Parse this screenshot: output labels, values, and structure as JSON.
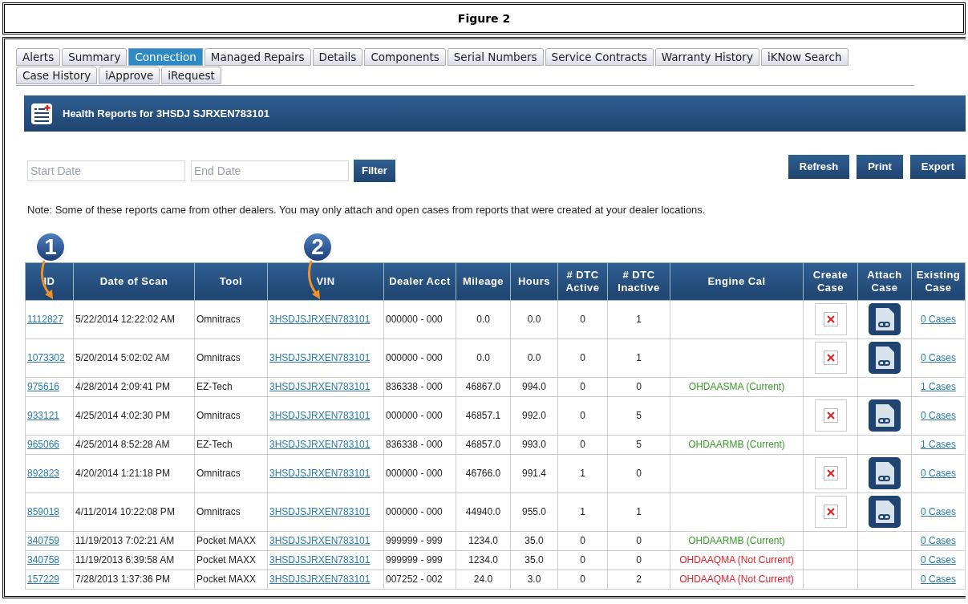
{
  "figure_title": "Figure 2",
  "tabs": [
    {
      "label": "Alerts",
      "selected": false
    },
    {
      "label": "Summary",
      "selected": false
    },
    {
      "label": "Connection",
      "selected": true
    },
    {
      "label": "Managed Repairs",
      "selected": false
    },
    {
      "label": "Details",
      "selected": false
    },
    {
      "label": "Components",
      "selected": false
    },
    {
      "label": "Serial Numbers",
      "selected": false
    },
    {
      "label": "Service Contracts",
      "selected": false
    },
    {
      "label": "Warranty History",
      "selected": false
    },
    {
      "label": "iKNow Search",
      "selected": false
    },
    {
      "label": "Case History",
      "selected": false
    },
    {
      "label": "iApprove",
      "selected": false
    },
    {
      "label": "iRequest",
      "selected": false
    }
  ],
  "panel_title": "Health Reports for 3HSDJ SJRXEN783101",
  "filter": {
    "start_placeholder": "Start Date",
    "end_placeholder": "End Date",
    "button": "Filter"
  },
  "actions": [
    "Refresh",
    "Print",
    "Export"
  ],
  "note": "Note: Some of these reports came from other dealers. You may only attach and open cases from reports that were created at your dealer locations.",
  "callouts": [
    "1",
    "2"
  ],
  "table": {
    "columns": [
      "ID",
      "Date of Scan",
      "Tool",
      "VIN",
      "Dealer Acct",
      "Mileage",
      "Hours",
      "# DTC Active",
      "# DTC Inactive",
      "Engine Cal",
      "Create Case",
      "Attach Case",
      "Existing Case"
    ],
    "rows": [
      {
        "id": "1112827",
        "date": "5/22/2014 12:22:02 AM",
        "tool": "Omnitracs",
        "vin": "3HSDJSJRXEN783101",
        "acct": "000000 - 000",
        "mileage": "0.0",
        "hours": "0.0",
        "dtc_active": "0",
        "dtc_inactive": "1",
        "can_create": true,
        "existing": "0 Cases"
      },
      {
        "id": "1073302",
        "date": "5/20/2014 5:02:02 AM",
        "tool": "Omnitracs",
        "vin": "3HSDJSJRXEN783101",
        "acct": "000000 - 000",
        "mileage": "0.0",
        "hours": "0.0",
        "dtc_active": "0",
        "dtc_inactive": "1",
        "can_create": true,
        "existing": "0 Cases"
      },
      {
        "id": "975616",
        "date": "4/28/2014 2:09:41 PM",
        "tool": "EZ-Tech",
        "vin": "3HSDJSJRXEN783101",
        "acct": "836338 - 000",
        "mileage": "46867.0",
        "hours": "994.0",
        "dtc_active": "0",
        "dtc_inactive": "0",
        "engine_cal": "OHDAASMA (Current)",
        "cal_current": true,
        "can_create": false,
        "existing": "1 Cases"
      },
      {
        "id": "933121",
        "date": "4/25/2014 4:02:30 PM",
        "tool": "Omnitracs",
        "vin": "3HSDJSJRXEN783101",
        "acct": "000000 - 000",
        "mileage": "46857.1",
        "hours": "992.0",
        "dtc_active": "0",
        "dtc_inactive": "5",
        "can_create": true,
        "existing": "0 Cases"
      },
      {
        "id": "965066",
        "date": "4/25/2014 8:52:28 AM",
        "tool": "EZ-Tech",
        "vin": "3HSDJSJRXEN783101",
        "acct": "836338 - 000",
        "mileage": "46857.0",
        "hours": "993.0",
        "dtc_active": "0",
        "dtc_inactive": "5",
        "engine_cal": "OHDAARMB (Current)",
        "cal_current": true,
        "can_create": false,
        "existing": "1 Cases"
      },
      {
        "id": "892823",
        "date": "4/20/2014 1:21:18 PM",
        "tool": "Omnitracs",
        "vin": "3HSDJSJRXEN783101",
        "acct": "000000 - 000",
        "mileage": "46766.0",
        "hours": "991.4",
        "dtc_active": "1",
        "dtc_inactive": "0",
        "can_create": true,
        "existing": "0 Cases"
      },
      {
        "id": "859018",
        "date": "4/11/2014 10:22:08 PM",
        "tool": "Omnitracs",
        "vin": "3HSDJSJRXEN783101",
        "acct": "000000 - 000",
        "mileage": "44940.0",
        "hours": "955.0",
        "dtc_active": "1",
        "dtc_inactive": "1",
        "can_create": true,
        "existing": "0 Cases"
      },
      {
        "id": "340759",
        "date": "11/19/2013 7:02:21 AM",
        "tool": "Pocket MAXX",
        "vin": "3HSDJSJRXEN783101",
        "acct": "999999 - 999",
        "mileage": "1234.0",
        "hours": "35.0",
        "dtc_active": "0",
        "dtc_inactive": "0",
        "engine_cal": "OHDAARMB (Current)",
        "cal_current": true,
        "can_create": false,
        "existing": "0 Cases"
      },
      {
        "id": "340758",
        "date": "11/19/2013 6:39:58 AM",
        "tool": "Pocket MAXX",
        "vin": "3HSDJSJRXEN783101",
        "acct": "999999 - 999",
        "mileage": "1234.0",
        "hours": "35.0",
        "dtc_active": "0",
        "dtc_inactive": "0",
        "engine_cal": "OHDAAQMA (Not Current)",
        "cal_current": false,
        "can_create": false,
        "existing": "0 Cases"
      },
      {
        "id": "157229",
        "date": "7/28/2013 1:37:36 PM",
        "tool": "Pocket MAXX",
        "vin": "3HSDJSJRXEN783101",
        "acct": "007252 - 002",
        "mileage": "24.0",
        "hours": "3.0",
        "dtc_active": "0",
        "dtc_inactive": "2",
        "engine_cal": "OHDAAQMA (Not Current)",
        "cal_current": false,
        "can_create": false,
        "existing": "0 Cases"
      }
    ]
  }
}
